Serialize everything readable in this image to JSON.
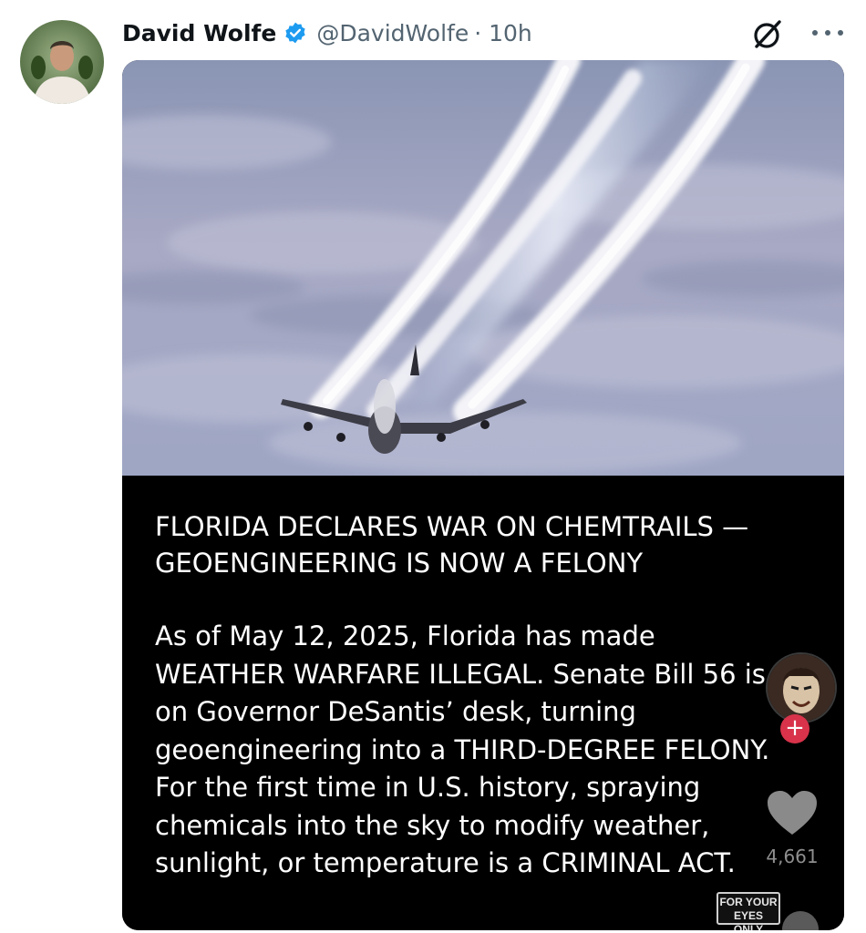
{
  "post": {
    "author_name": "David Wolfe",
    "author_handle": "@DavidWolfe",
    "time": "· 10h",
    "header_icons": [
      "verified-badge-icon",
      "grok-icon",
      "more-options-icon"
    ],
    "colors": {
      "verified": "#1d9bf0",
      "handle": "#536471",
      "name": "#0f1419"
    }
  },
  "media": {
    "headline": "FLORIDA DECLARES WAR ON CHEMTRAILS — GEOENGINEERING IS NOW A FELONY",
    "body": "As of May 12, 2025, Florida has made WEATHER WARFARE ILLEGAL. Senate Bill 56 is on Governor DeSantis’ desk, turning geoengineering into a THIRD-DEGREE FELONY. For the first time in U.S. history, spraying chemicals into the sky to modify weather, sunlight, or temperature is a CRIMINAL ACT.",
    "overlay": {
      "follow_symbol": "+",
      "like_count": "4,661",
      "stamp_line1": "FOR YOUR",
      "stamp_line2": "EYES ONLY",
      "icons": [
        "creator-avatar",
        "plus-icon",
        "heart-icon"
      ]
    }
  }
}
